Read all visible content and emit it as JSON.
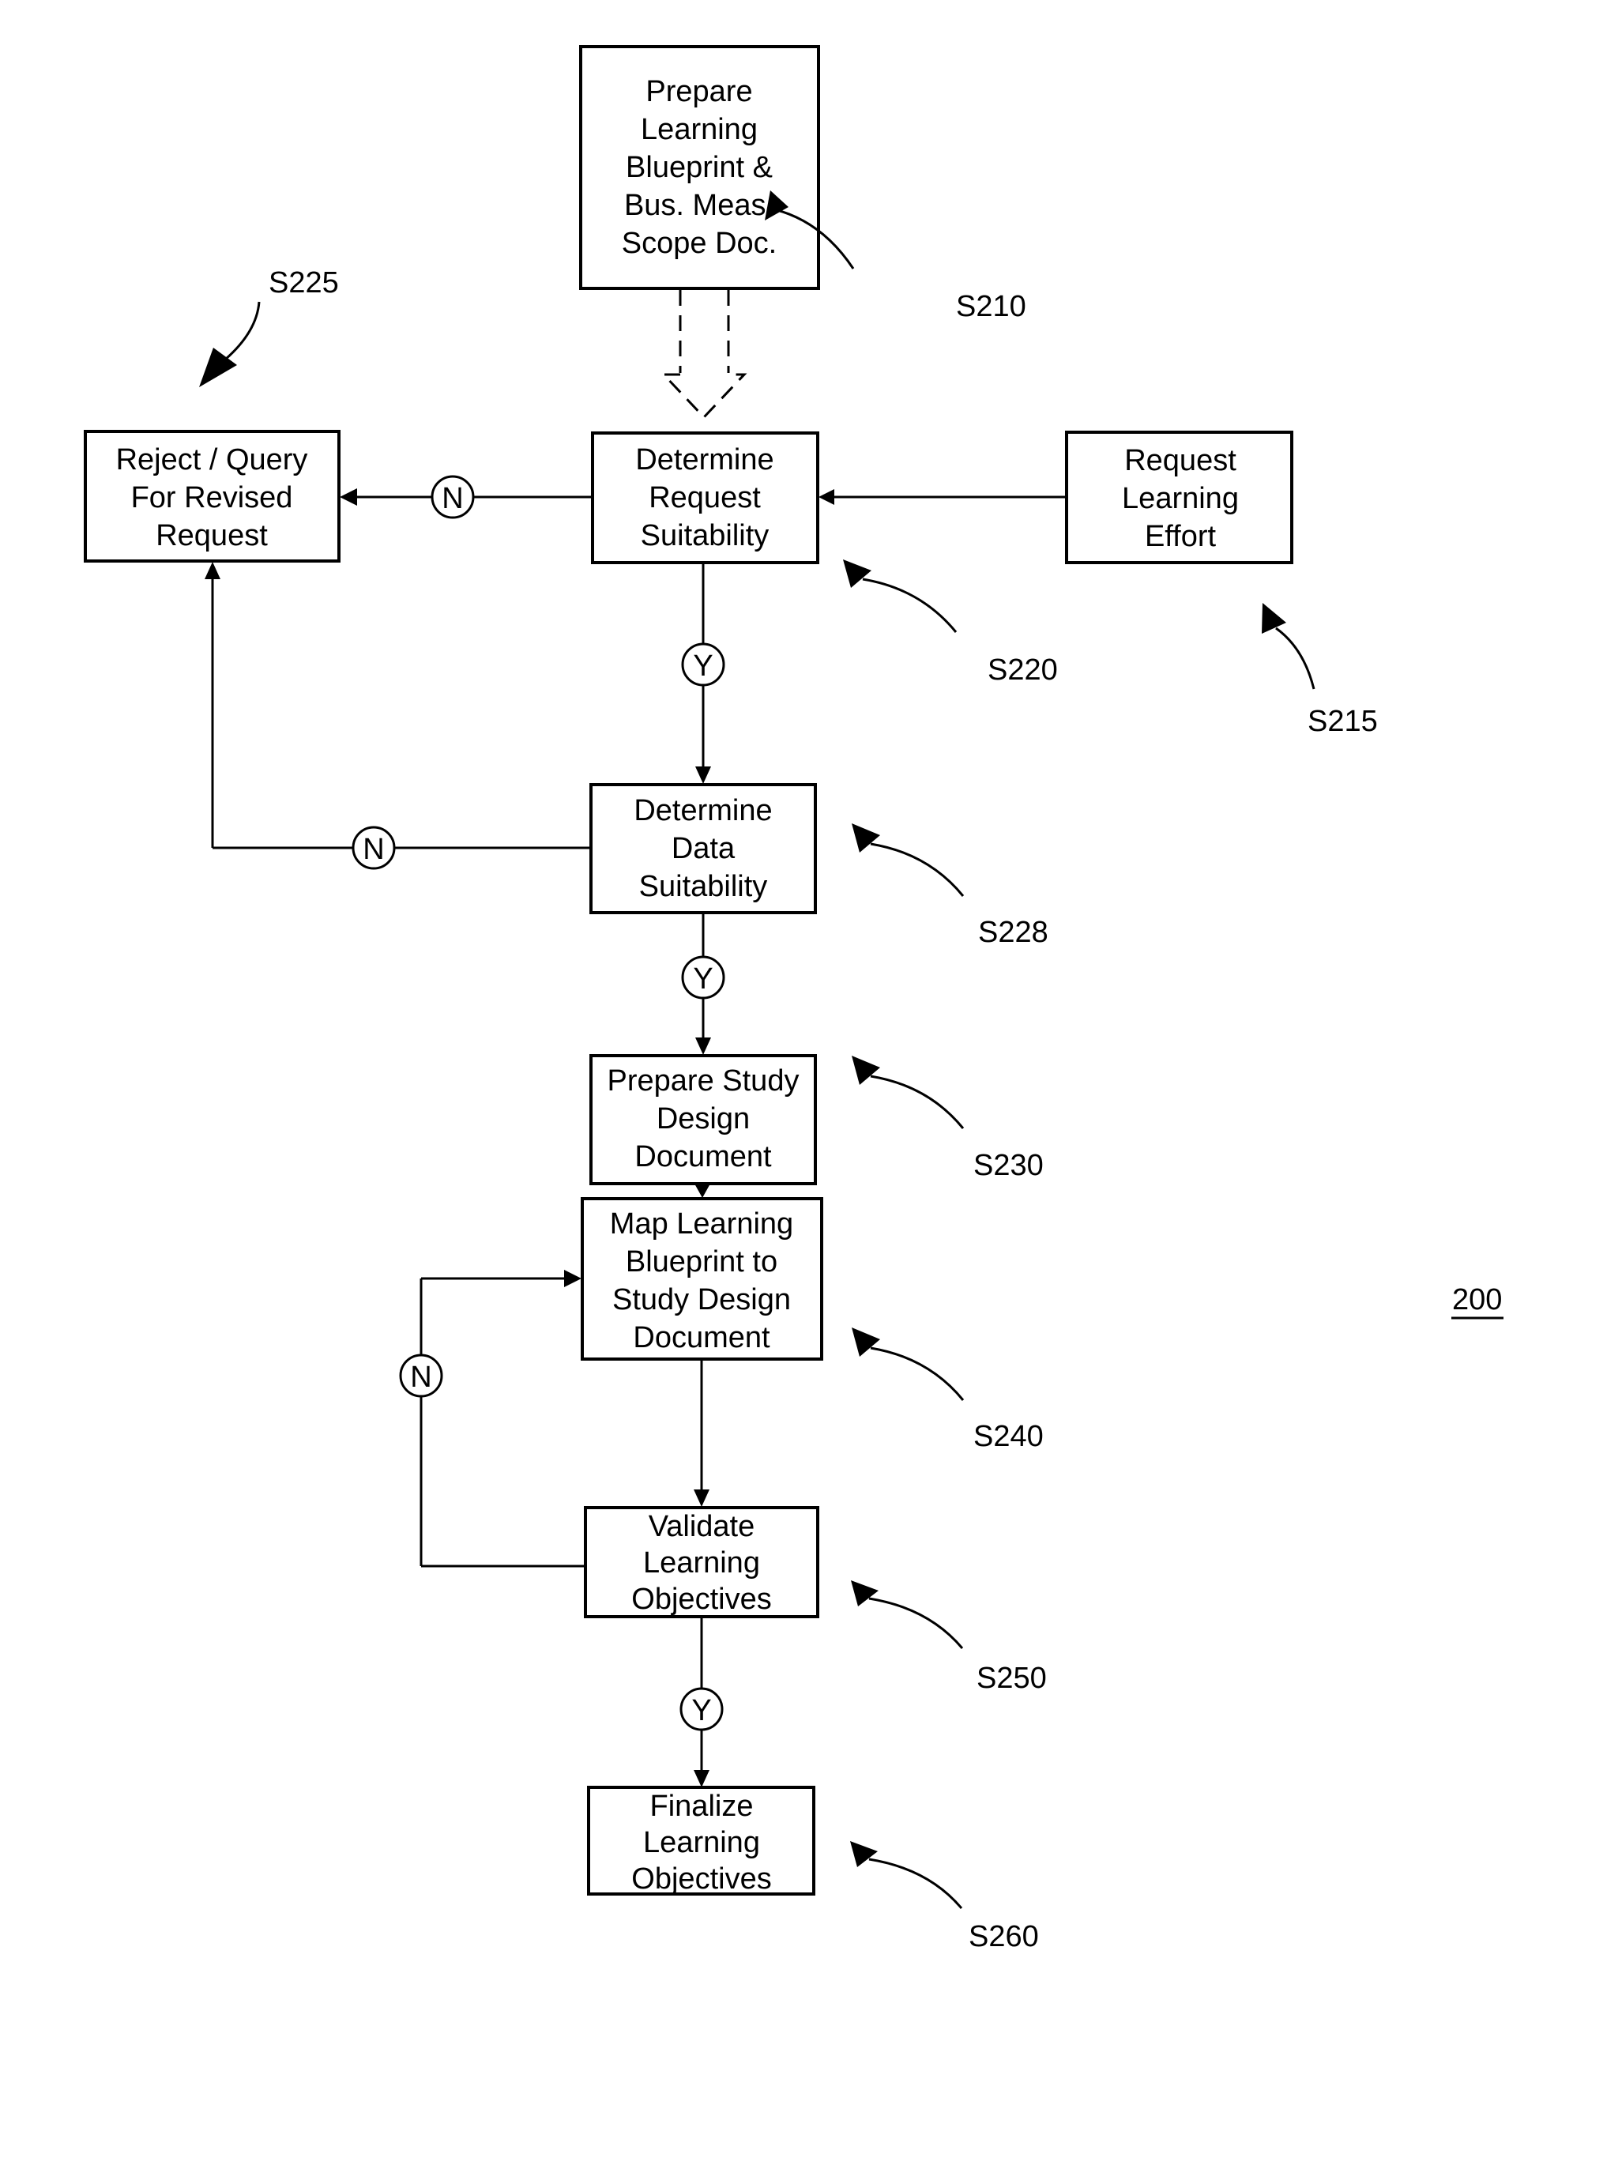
{
  "figure": {
    "number": "200",
    "steps": {
      "s210": {
        "id": "S210",
        "lines": [
          "Prepare",
          "Learning",
          "Blueprint &",
          "Bus. Meas.",
          "Scope Doc."
        ]
      },
      "s215": {
        "id": "S215",
        "lines": [
          "Request",
          "Learning",
          "Effort"
        ]
      },
      "s220": {
        "id": "S220",
        "lines": [
          "Determine",
          "Request",
          "Suitability"
        ]
      },
      "s225": {
        "id": "S225",
        "lines": [
          "Reject / Query",
          "For Revised",
          "Request"
        ]
      },
      "s228": {
        "id": "S228",
        "lines": [
          "Determine",
          "Data",
          "Suitability"
        ]
      },
      "s230": {
        "id": "S230",
        "lines": [
          "Prepare Study",
          "Design",
          "Document"
        ]
      },
      "s240": {
        "id": "S240",
        "lines": [
          "Map Learning",
          "Blueprint to",
          "Study Design",
          "Document"
        ]
      },
      "s250": {
        "id": "S250",
        "lines": [
          "Validate",
          "Learning",
          "Objectives"
        ]
      },
      "s260": {
        "id": "S260",
        "lines": [
          "Finalize",
          "Learning",
          "Objectives"
        ]
      }
    },
    "decisions": {
      "yes": "Y",
      "no": "N"
    },
    "connections": [
      {
        "from": "S210",
        "to": "S220",
        "style": "dashed-hollow-arrow"
      },
      {
        "from": "S215",
        "to": "S220",
        "label": ""
      },
      {
        "from": "S220",
        "to": "S225",
        "label": "N"
      },
      {
        "from": "S220",
        "to": "S228",
        "label": "Y"
      },
      {
        "from": "S228",
        "to": "S225",
        "label": "N"
      },
      {
        "from": "S228",
        "to": "S230",
        "label": "Y"
      },
      {
        "from": "S230",
        "to": "S240",
        "label": ""
      },
      {
        "from": "S240",
        "to": "S250",
        "label": ""
      },
      {
        "from": "S250",
        "to": "S240",
        "label": "N"
      },
      {
        "from": "S250",
        "to": "S260",
        "label": "Y"
      }
    ]
  }
}
